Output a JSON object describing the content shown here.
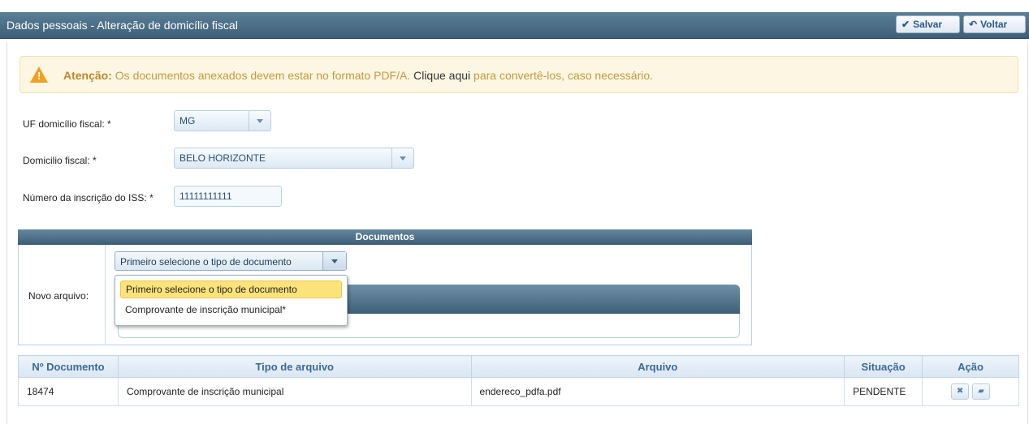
{
  "header": {
    "title": "Dados pessoais - Alteração de domicílio fiscal",
    "save_label": "Salvar",
    "back_label": "Voltar",
    "save_icon": "check-icon",
    "back_icon": "back-arrow-icon"
  },
  "alert": {
    "icon": "warning-icon",
    "prefix": "Atenção:",
    "text": " Os documentos anexados devem estar no formato PDF/A.",
    "link": " Clique aqui",
    "suffix": " para convertê-los, caso necessário."
  },
  "form": {
    "uf_label": "UF domicílio fiscal: *",
    "uf_value": "MG",
    "domicilio_label": "Domicilio fiscal: *",
    "domicilio_value": "BELO HORIZONTE",
    "iss_label": "Número da inscrição do ISS: *",
    "iss_value": "11111111111"
  },
  "documents": {
    "section_title": "Documentos",
    "novo_label": "Novo arquivo:",
    "select_value": "Primeiro selecione o tipo de documento",
    "options": [
      "Primeiro selecione o tipo de documento",
      "Comprovante de inscrição municipal*"
    ]
  },
  "table": {
    "headers": [
      "Nº Documento",
      "Tipo de arquivo",
      "Arquivo",
      "Situação",
      "Ação"
    ],
    "rows": [
      {
        "numero": "18474",
        "tipo": "Comprovante de inscrição municipal",
        "arquivo": "endereco_pdfa.pdf",
        "situacao": "PENDENTE",
        "actions": [
          "delete-icon",
          "folder-open-icon"
        ]
      }
    ]
  }
}
